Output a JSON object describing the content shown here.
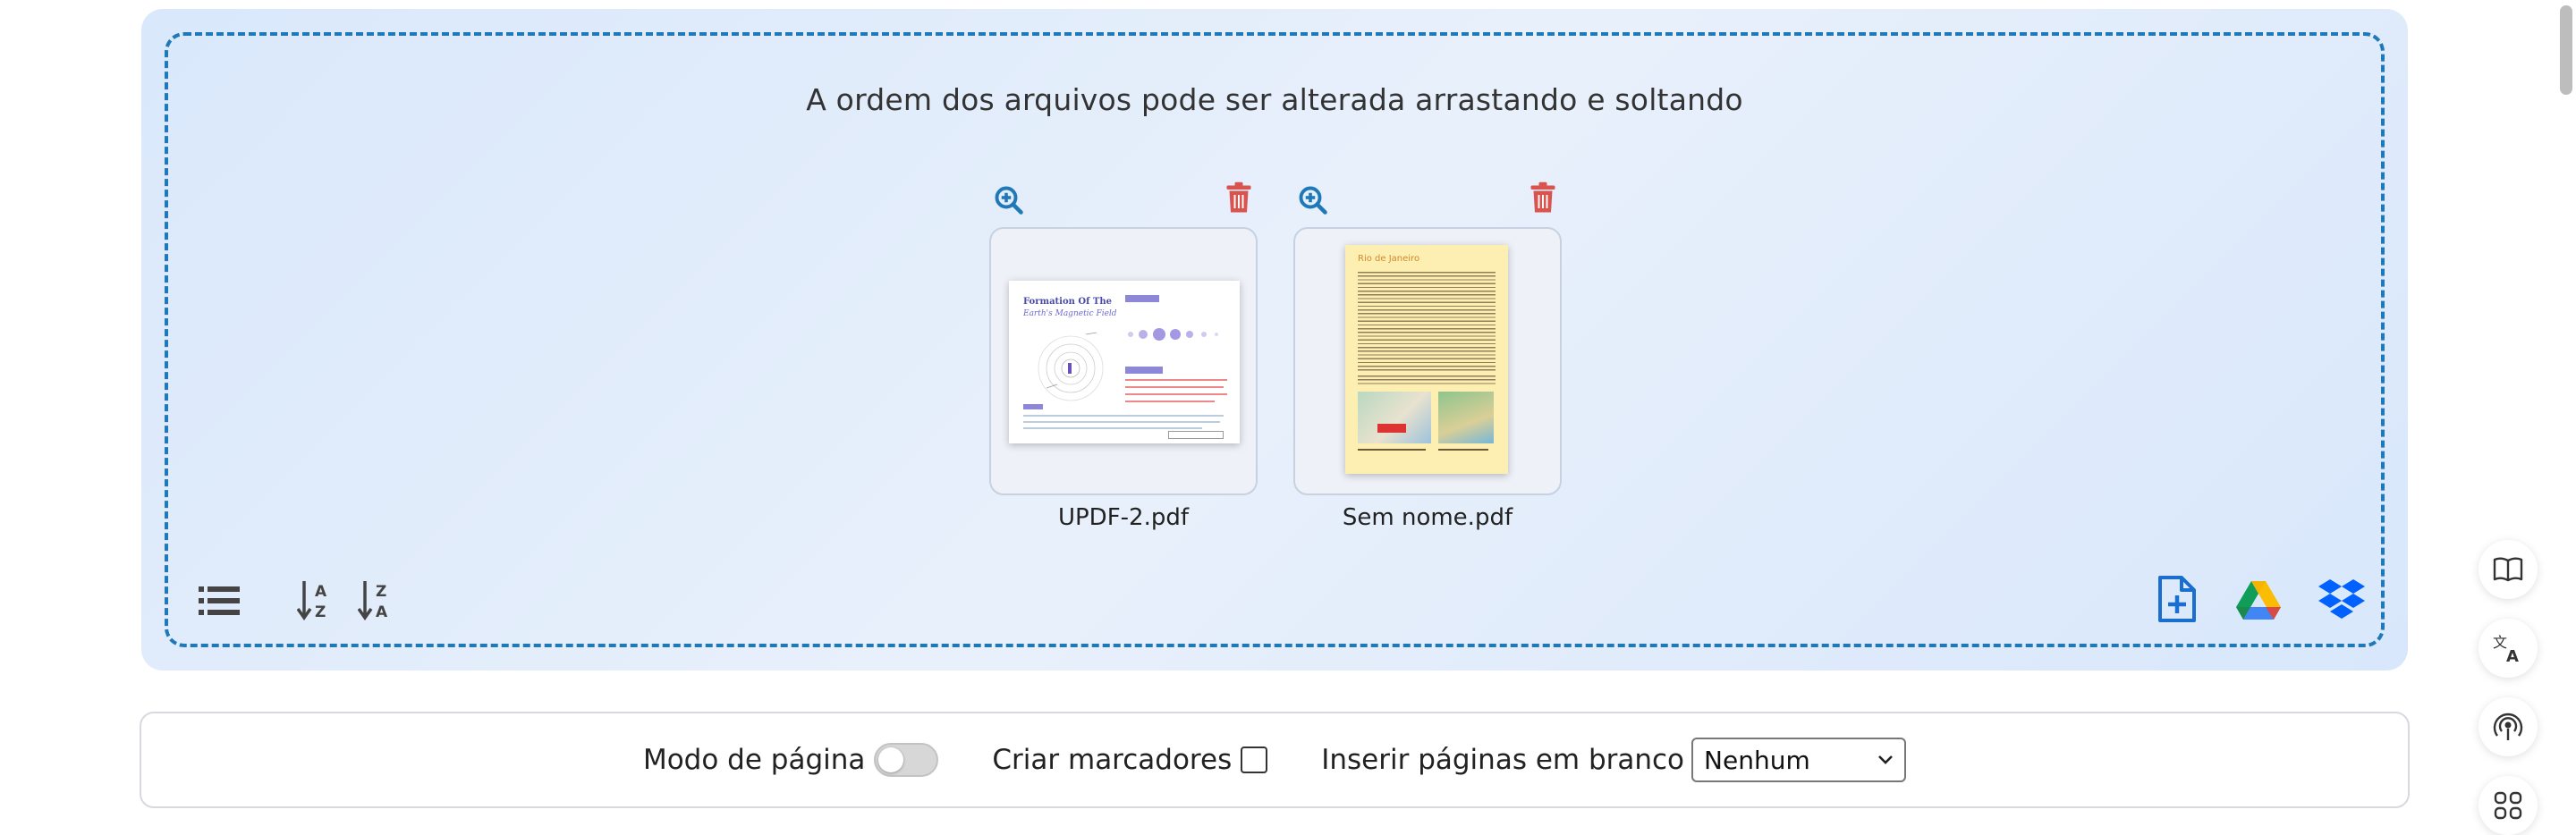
{
  "dropzone": {
    "hint": "A ordem dos arquivos pode ser alterada arrastando e soltando"
  },
  "files": [
    {
      "name": "UPDF-2.pdf",
      "thumbnail": {
        "title_line1": "Formation Of The",
        "title_line2": "Earth's Magnetic Field"
      }
    },
    {
      "name": "Sem nome.pdf",
      "thumbnail": {
        "title": "Rio de Janeiro"
      }
    }
  ],
  "options": {
    "page_mode_label": "Modo de página",
    "bookmarks_label": "Criar marcadores",
    "blank_pages_label": "Inserir páginas em branco",
    "blank_pages_value": "Nenhum"
  },
  "colors": {
    "accent_blue": "#1f78b8",
    "delete_red": "#d9534f",
    "dropzone_bg": "#e3edfb"
  },
  "icons": {
    "list": "list-icon",
    "sort_az": "sort-az-icon",
    "sort_za": "sort-za-icon",
    "add_file": "add-file-icon",
    "google_drive": "google-drive-icon",
    "dropbox": "dropbox-icon",
    "side": [
      "book-icon",
      "translate-icon",
      "broadcast-icon",
      "apps-icon"
    ]
  }
}
